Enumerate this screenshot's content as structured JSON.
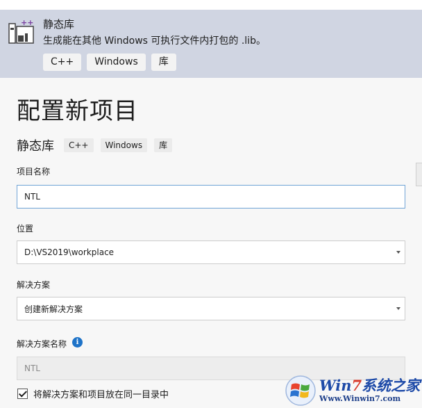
{
  "template_card": {
    "icon": "static-library-icon",
    "title": "静态库",
    "description": "生成能在其他 Windows 可执行文件内打包的 .lib。",
    "tags": [
      "C++",
      "Windows",
      "库"
    ]
  },
  "main": {
    "page_title": "配置新项目",
    "subtitle": "静态库",
    "tags": [
      "C++",
      "Windows",
      "库"
    ],
    "project_name": {
      "label": "项目名称",
      "value": "NTL"
    },
    "location": {
      "label": "位置",
      "value": "D:\\VS2019\\workplace"
    },
    "solution": {
      "label": "解决方案",
      "value": "创建新解决方案"
    },
    "solution_name": {
      "label": "解决方案名称",
      "value": "NTL",
      "info_icon": "info-icon"
    },
    "same_dir_checkbox": {
      "label": "将解决方案和项目放在同一目录中",
      "checked": true
    }
  },
  "watermark": {
    "brand_prefix": "Win",
    "brand_seven": "7",
    "brand_suffix": "系统之家",
    "url": "Www.Winwin7.com"
  }
}
